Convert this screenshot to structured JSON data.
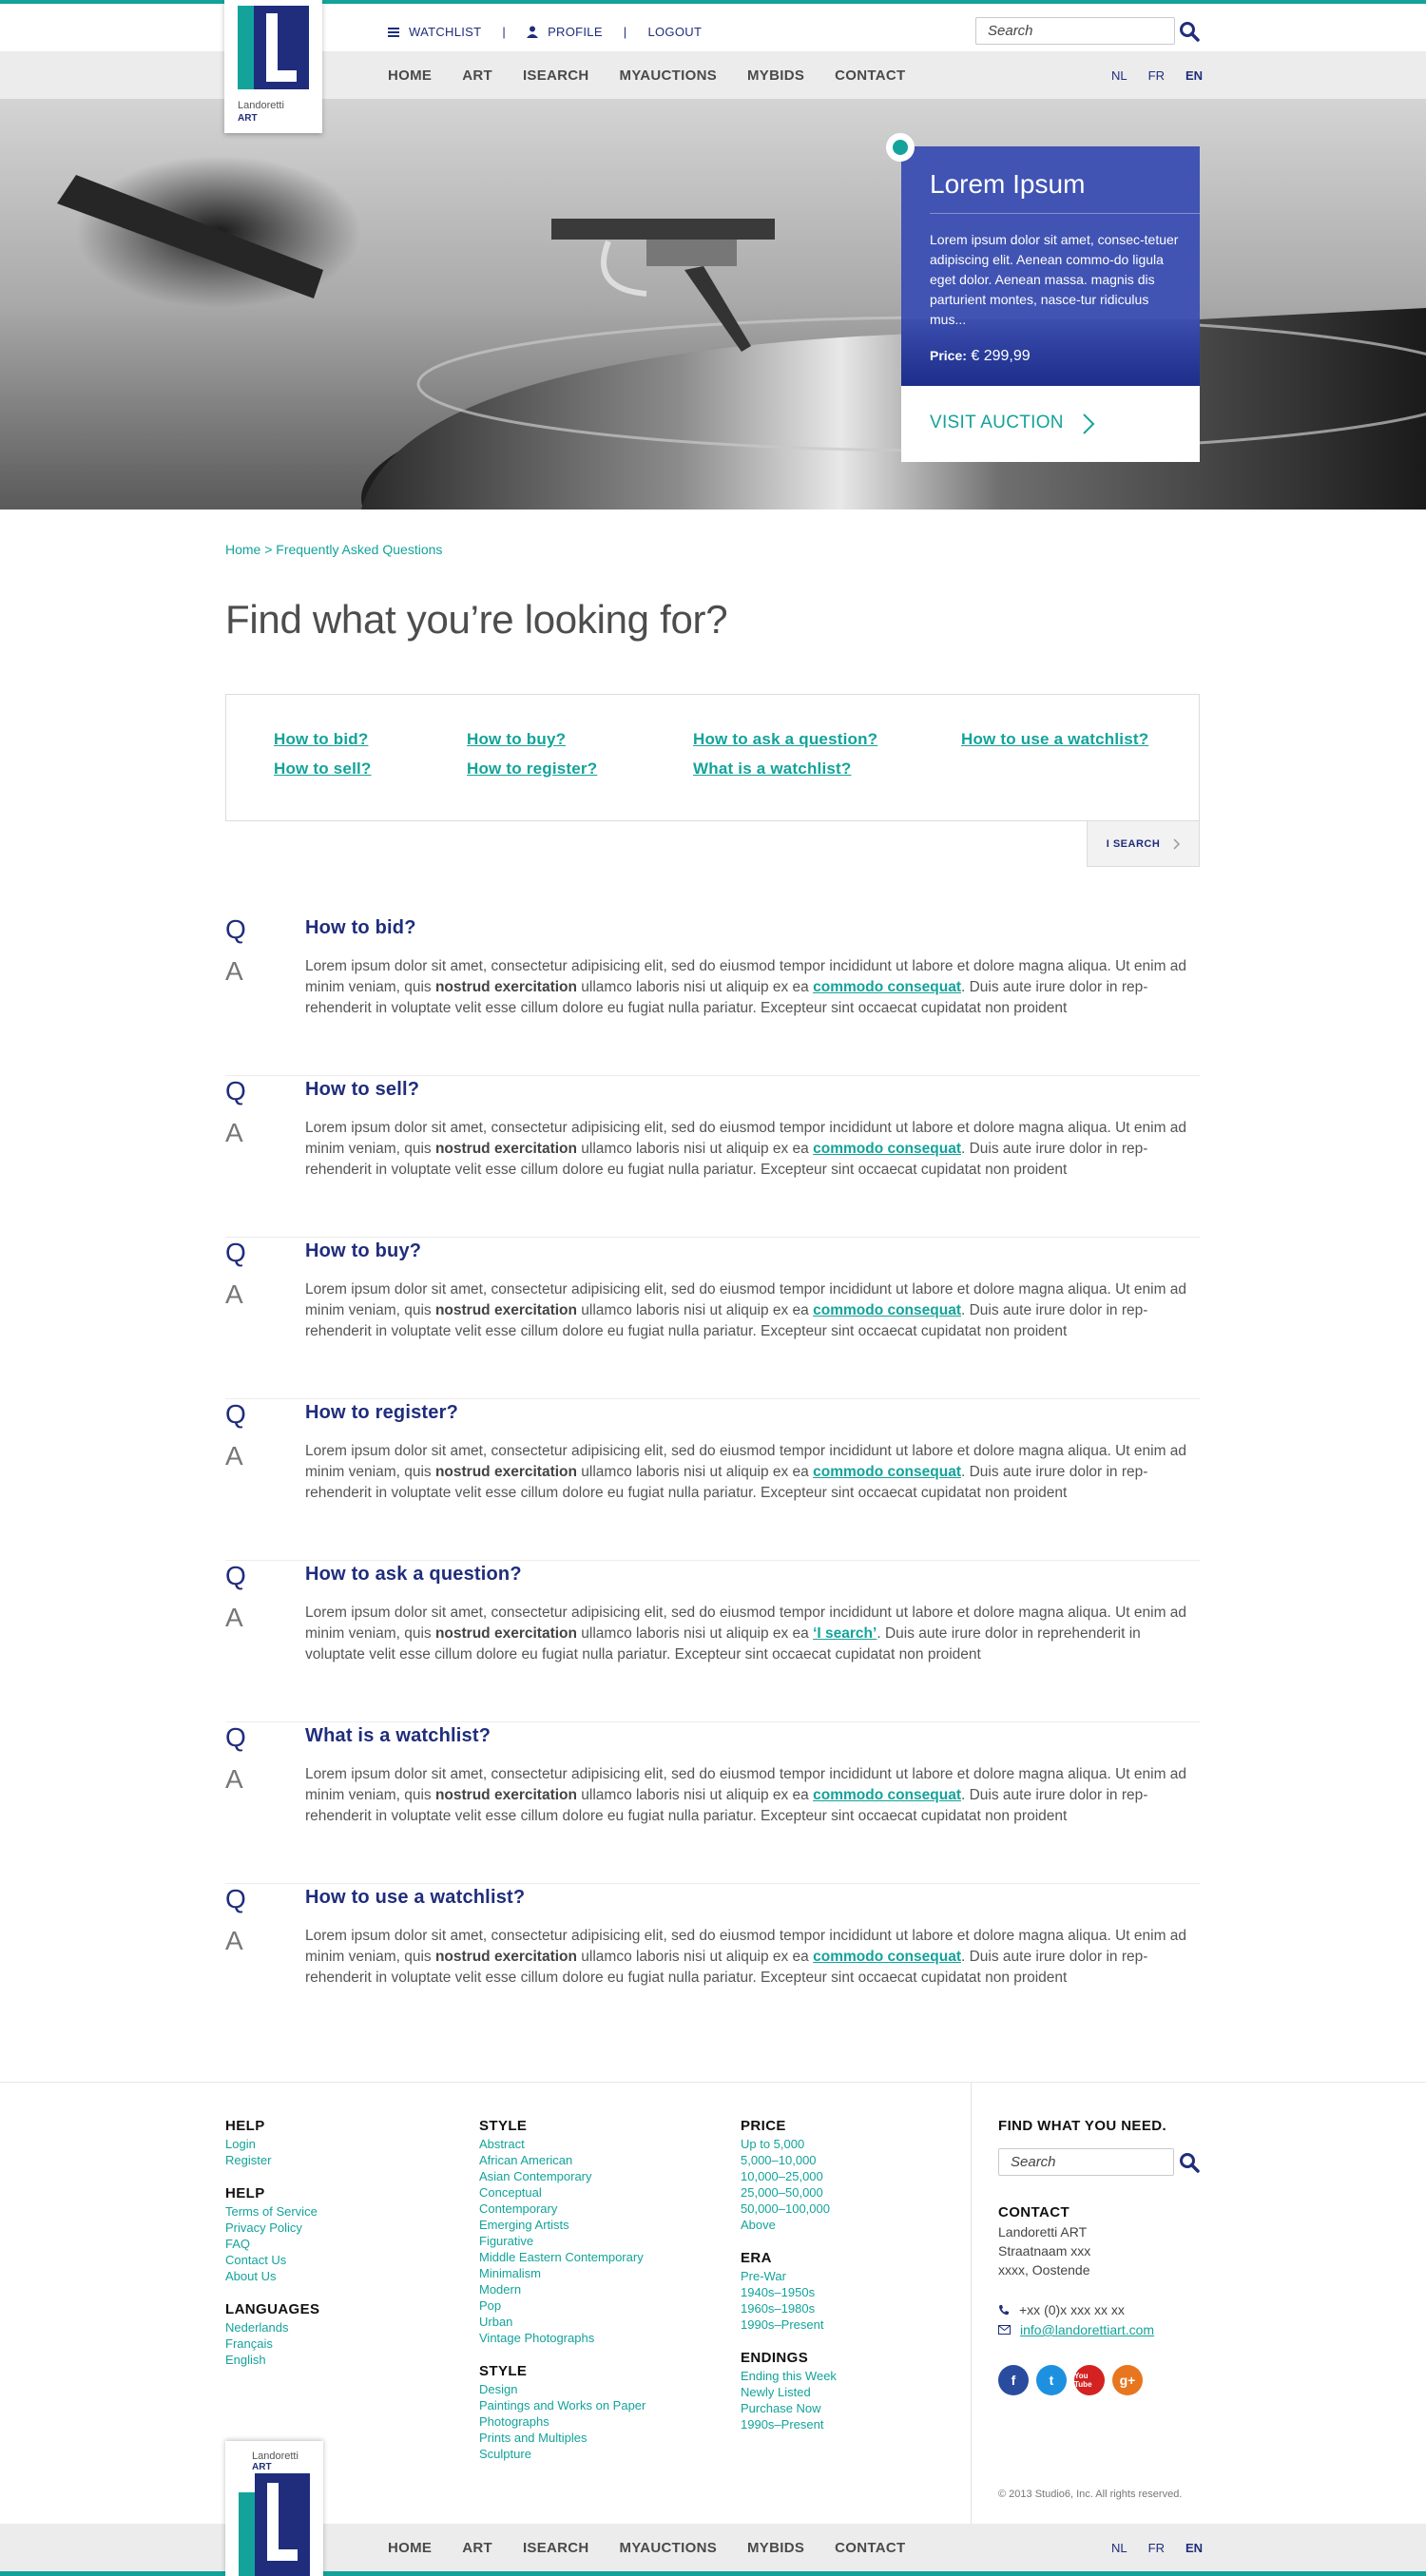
{
  "header": {
    "watchlist": "WATCHLIST",
    "sep1": "|",
    "profile": "PROFILE",
    "sep2": "|",
    "logout": "LOGOUT",
    "search_placeholder": "Search"
  },
  "logo": {
    "name": "Landoretti",
    "sub": "ART",
    "letter": "L"
  },
  "nav": {
    "items": [
      "HOME",
      "ART",
      "ISEARCH",
      "MYAUCTIONS",
      "MYBIDS",
      "CONTACT"
    ]
  },
  "languages": [
    "NL",
    "FR",
    "EN"
  ],
  "hero_card": {
    "title": "Lorem Ipsum",
    "text": "Lorem ipsum dolor sit amet, consec-tetuer adipiscing elit. Aenean commo-do ligula eget dolor. Aenean massa. magnis dis parturient montes, nasce-tur ridiculus mus...",
    "price_label": "Price:",
    "price_value": "€ 299,99",
    "cta": "VISIT AUCTION"
  },
  "breadcrumb": "Home > Frequently Asked Questions",
  "page_title": "Find what you’re looking for?",
  "quick_links": [
    "How to bid?",
    "How to sell?",
    "How to buy?",
    "How to register?",
    "How to ask a question?",
    "What is a watchlist?",
    "How to use a watchlist?"
  ],
  "isearch_button": "I SEARCH",
  "faq": {
    "q_marker": "Q",
    "a_marker": "A",
    "answer_part1": "Lorem ipsum dolor sit amet, consectetur adipisicing elit, sed do eiusmod tempor incididunt ut labore et dolore magna aliqua. Ut enim ad minim veniam, quis ",
    "answer_bold": "nostrud exercitation",
    "answer_part2": " ullamco laboris nisi ut aliquip ex ea ",
    "answer_link": "commodo consequat",
    "answer_part3": ". Duis aute irure dolor in rep-rehenderit in voluptate velit esse cillum dolore eu fugiat nulla pariatur. Excepteur sint occaecat cupidatat non proident",
    "answer_link_alt": "‘I search’",
    "answer_part3_alt": ". Duis aute irure dolor in reprehenderit in voluptate velit esse cillum dolore eu fugiat nulla pariatur. Excepteur sint occaecat cupidatat non proident",
    "questions": [
      "How to bid?",
      "How to sell?",
      "How to buy?",
      "How to register?",
      "How to ask a question?",
      "What is a watchlist?",
      "How to use a watchlist?"
    ]
  },
  "footer": {
    "col1": [
      {
        "title": "HELP",
        "items": [
          "Login",
          "Register"
        ]
      },
      {
        "title": "HELP",
        "items": [
          "Terms of Service",
          "Privacy Policy",
          "FAQ",
          "Contact Us",
          "About Us"
        ]
      },
      {
        "title": "LANGUAGES",
        "items": [
          "Nederlands",
          "Français",
          "English"
        ]
      }
    ],
    "col2": [
      {
        "title": "STYLE",
        "items": [
          "Abstract",
          "African American",
          "Asian Contemporary",
          "Conceptual",
          "Contemporary",
          "Emerging Artists",
          "Figurative",
          "Middle Eastern Contemporary",
          "Minimalism",
          "Modern",
          "Pop",
          "Urban",
          "Vintage Photographs"
        ]
      },
      {
        "title": "STYLE",
        "items": [
          "Design",
          "Paintings and Works on Paper",
          "Photographs",
          "Prints and Multiples",
          "Sculpture"
        ]
      }
    ],
    "col3": [
      {
        "title": "PRICE",
        "items": [
          "Up to 5,000",
          "5,000–10,000",
          "10,000–25,000",
          "25,000–50,000",
          "50,000–100,000",
          "Above"
        ]
      },
      {
        "title": "ERA",
        "items": [
          "Pre-War",
          "1940s–1950s",
          "1960s–1980s",
          "1990s–Present"
        ]
      },
      {
        "title": "ENDINGS",
        "items": [
          "Ending this Week",
          "Newly Listed",
          "Purchase Now",
          "1990s–Present"
        ]
      }
    ],
    "find_title": "FIND WHAT YOU NEED.",
    "search_placeholder": "Search",
    "contact_title": "CONTACT",
    "contact_lines": [
      "Landoretti ART",
      "Straatnaam xxx",
      "xxxx, Oostende"
    ],
    "phone": "+xx (0)x xxx xx xx",
    "email": "info@landorettiart.com",
    "social": [
      {
        "name": "facebook",
        "glyph": "f",
        "color": "#2a4c9e"
      },
      {
        "name": "twitter",
        "glyph": "t",
        "color": "#1e90e0"
      },
      {
        "name": "youtube",
        "glyph": "You Tube",
        "color": "#d42222"
      },
      {
        "name": "google-plus",
        "glyph": "g+",
        "color": "#e8761e"
      }
    ],
    "copyright": "© 2013 Studio6, Inc. All rights reserved."
  },
  "colors": {
    "teal": "#13a39a",
    "navy": "#1f2d7c",
    "card_blue": "#4154b4"
  }
}
